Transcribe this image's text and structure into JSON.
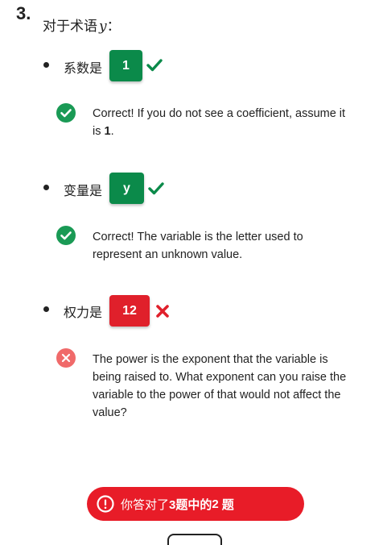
{
  "question": {
    "number": "3.",
    "prompt": "对于术语",
    "variable": "y",
    "colon": "："
  },
  "items": [
    {
      "term": "系数是",
      "answer": "1",
      "status": "correct",
      "feedback_lead": "Correct! If you do not see a coefficient, assume it is ",
      "feedback_bold": "1",
      "feedback_tail": "."
    },
    {
      "term": "变量是",
      "answer": "y",
      "status": "correct",
      "feedback": "Correct! The variable is the letter used to represent an unknown value."
    },
    {
      "term": "权力是",
      "answer": "12",
      "status": "incorrect",
      "feedback": "The power is the exponent that the variable is being raised to. What exponent can you raise the variable to the power of that would not affect the value?"
    }
  ],
  "score": {
    "prefix": "你答对了",
    "count": "3题",
    "mid": "中的",
    "correct": "2",
    "suffix": "题"
  },
  "colors": {
    "correct": "#0b8a4a",
    "incorrect": "#e0202b",
    "feedback_correct_icon": "#1a9a55",
    "feedback_incorrect_icon": "#f06a6a",
    "score_banner": "#e81c28"
  },
  "icons": {
    "correct_mark": "checkmark-icon",
    "incorrect_mark": "x-mark-icon",
    "feedback_correct": "check-circle-icon",
    "feedback_incorrect": "x-circle-icon",
    "score_alert": "alert-circle-icon"
  }
}
